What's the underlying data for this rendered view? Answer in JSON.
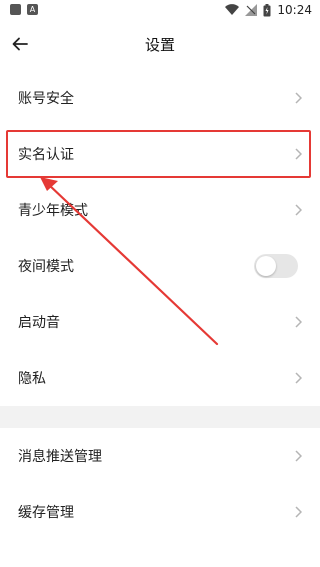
{
  "statusbar": {
    "time": "10:24",
    "icon_a_label": "A"
  },
  "header": {
    "title": "设置"
  },
  "items": [
    {
      "label": "账号安全"
    },
    {
      "label": "实名认证"
    },
    {
      "label": "青少年模式"
    },
    {
      "label": "夜间模式",
      "toggle": false
    },
    {
      "label": "启动音"
    },
    {
      "label": "隐私"
    }
  ],
  "items2": [
    {
      "label": "消息推送管理"
    },
    {
      "label": "缓存管理"
    }
  ],
  "colors": {
    "highlight": "#e53935",
    "chevron": "#b5b5b5",
    "section_gap": "#f2f2f2"
  }
}
